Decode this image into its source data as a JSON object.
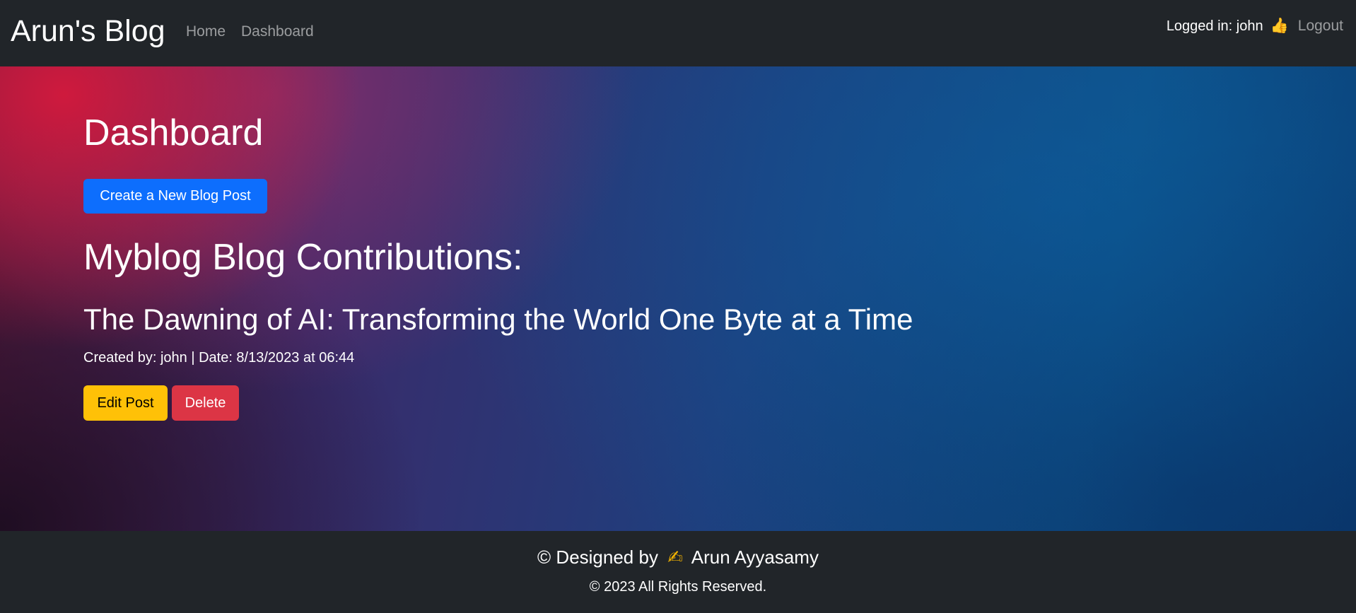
{
  "navbar": {
    "brand": "Arun's Blog",
    "links": [
      {
        "label": "Home"
      },
      {
        "label": "Dashboard"
      }
    ],
    "logged_in_text": "Logged in: john",
    "status_icon": "thumbs-up-icon",
    "logout_label": "Logout"
  },
  "main": {
    "page_title": "Dashboard",
    "create_button_label": "Create a New Blog Post",
    "section_title": "Myblog Blog Contributions:",
    "posts": [
      {
        "title": "The Dawning of AI: Transforming the World One Byte at a Time",
        "meta": "Created by: john | Date: 8/13/2023 at 06:44",
        "edit_label": "Edit Post",
        "delete_label": "Delete"
      }
    ]
  },
  "footer": {
    "designed_prefix": "© Designed by",
    "designer_icon": "writing-hand-icon",
    "designer_name": "Arun Ayyasamy",
    "copyright": "© 2023 All Rights Reserved."
  },
  "colors": {
    "navbar_bg": "#212529",
    "primary": "#0d6efd",
    "warning": "#ffc107",
    "danger": "#dc3545"
  }
}
